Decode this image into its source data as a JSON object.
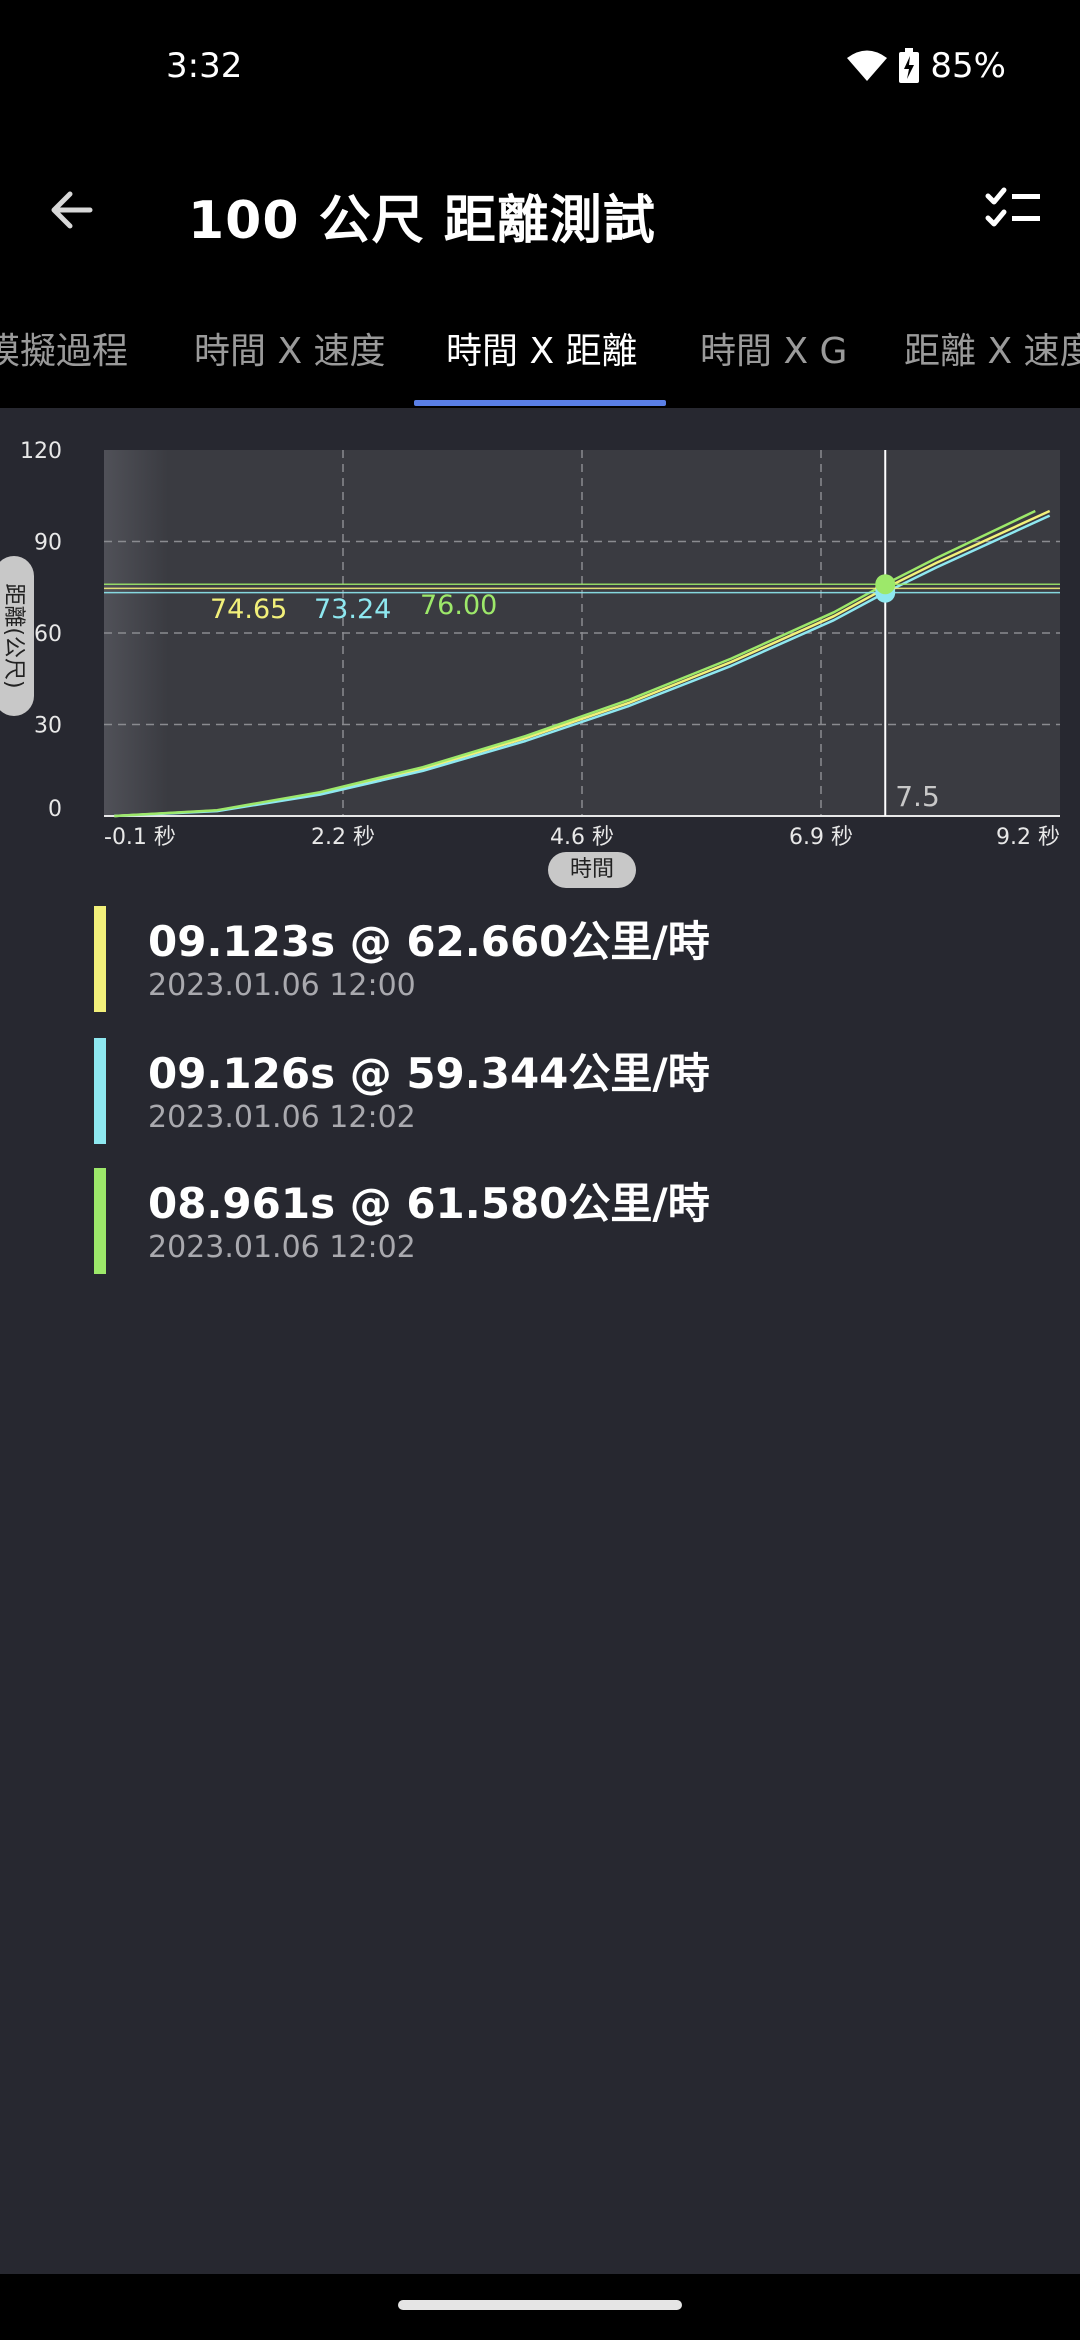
{
  "status": {
    "time": "3:32",
    "battery": "85%"
  },
  "header": {
    "title": "100 公尺 距離測試",
    "back_icon": "arrow-back-icon",
    "checklist_icon": "checklist-icon"
  },
  "tabs": [
    {
      "label": "模擬過程",
      "active": false
    },
    {
      "label": "時間 X 速度",
      "active": false
    },
    {
      "label": "時間 X 距離",
      "active": true
    },
    {
      "label": "時間 X G",
      "active": false
    },
    {
      "label": "距離 X 速度",
      "active": false
    }
  ],
  "chart_data": {
    "type": "line",
    "xlabel": "時間",
    "ylabel": "距離(公尺)",
    "xlim": [
      -0.1,
      9.2
    ],
    "ylim": [
      0,
      120
    ],
    "x_ticks": [
      "-0.1 秒",
      "2.2 秒",
      "4.6 秒",
      "6.9 秒",
      "9.2 秒"
    ],
    "y_ticks": [
      "0",
      "30",
      "60",
      "90",
      "120"
    ],
    "grid": true,
    "cursor": {
      "x": 7.5,
      "label": "7.5"
    },
    "series": [
      {
        "color": "#f2f07a",
        "cursor_value": "74.65",
        "x": [
          0,
          1,
          2,
          3,
          4,
          5,
          6,
          7,
          7.5,
          8,
          9.1
        ],
        "y": [
          0,
          1.8,
          7.5,
          15.5,
          25.5,
          37,
          50.5,
          65.5,
          74.65,
          83,
          100
        ]
      },
      {
        "color": "#8ee8f0",
        "cursor_value": "73.24",
        "x": [
          0,
          1,
          2,
          3,
          4,
          5,
          6,
          7,
          7.5,
          8,
          9.1
        ],
        "y": [
          0,
          1.6,
          7,
          14.8,
          24.6,
          36,
          49.2,
          64.2,
          73.24,
          81.5,
          98.5
        ]
      },
      {
        "color": "#9de86a",
        "cursor_value": "76.00",
        "x": [
          0,
          1,
          2,
          3,
          4,
          5,
          6,
          7,
          7.5,
          8,
          8.96
        ],
        "y": [
          0,
          1.9,
          7.8,
          16,
          26.2,
          38,
          51.6,
          66.8,
          76,
          84.6,
          100
        ]
      }
    ]
  },
  "runs": [
    {
      "color": "#f2f07a",
      "result": "09.123s @ 62.660公里/時",
      "date": "2023.01.06 12:00"
    },
    {
      "color": "#8ee8f0",
      "result": "09.126s @ 59.344公里/時",
      "date": "2023.01.06 12:02"
    },
    {
      "color": "#9de86a",
      "result": "08.961s @ 61.580公里/時",
      "date": "2023.01.06 12:02"
    }
  ]
}
